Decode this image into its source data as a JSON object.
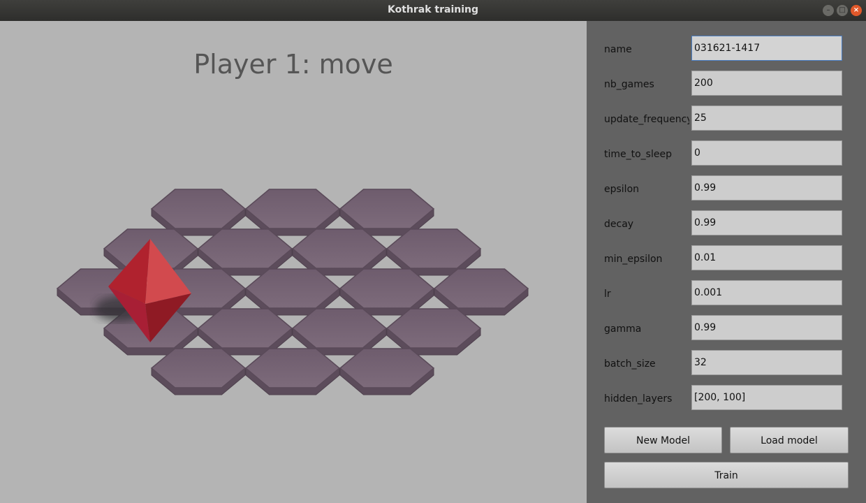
{
  "window": {
    "title": "Kothrak training",
    "minimize": "–",
    "maximize": "□",
    "close": "×"
  },
  "game": {
    "status": "Player 1: move",
    "tile_icon": "hex-tile",
    "player_icon": "red-octahedron-piece",
    "tile_color": "#776676",
    "piece_color": "#c8303c"
  },
  "form": [
    {
      "key": "name",
      "label": "name",
      "value": "031621-1417"
    },
    {
      "key": "nb_games",
      "label": "nb_games",
      "value": "200"
    },
    {
      "key": "update_frequency",
      "label": "update_frequency",
      "value": "25"
    },
    {
      "key": "time_to_sleep",
      "label": "time_to_sleep",
      "value": "0"
    },
    {
      "key": "epsilon",
      "label": "epsilon",
      "value": "0.99"
    },
    {
      "key": "decay",
      "label": "decay",
      "value": "0.99"
    },
    {
      "key": "min_epsilon",
      "label": "min_epsilon",
      "value": "0.01"
    },
    {
      "key": "lr",
      "label": "lr",
      "value": "0.001"
    },
    {
      "key": "gamma",
      "label": "gamma",
      "value": "0.99"
    },
    {
      "key": "batch_size",
      "label": "batch_size",
      "value": "32"
    },
    {
      "key": "hidden_layers",
      "label": "hidden_layers",
      "value": "[200, 100]"
    }
  ],
  "buttons": {
    "new_model": "New Model",
    "load_model": "Load model",
    "train": "Train"
  }
}
